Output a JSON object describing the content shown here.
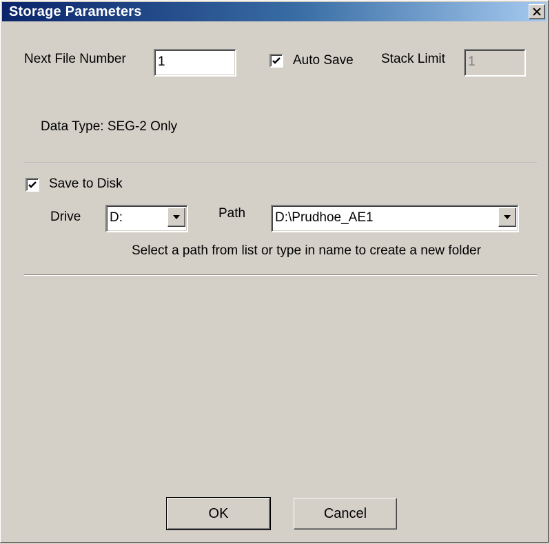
{
  "window": {
    "title": "Storage Parameters"
  },
  "form": {
    "next_file_number_label": "Next File Number",
    "next_file_number_value": "1",
    "auto_save_label": "Auto Save",
    "auto_save_checked": true,
    "stack_limit_label": "Stack Limit",
    "stack_limit_value": "1",
    "data_type_text": "Data Type: SEG-2 Only",
    "save_to_disk_label": "Save to Disk",
    "save_to_disk_checked": true,
    "drive_label": "Drive",
    "drive_value": "D:",
    "path_label": "Path",
    "path_value": "D:\\Prudhoe_AE1",
    "path_hint": "Select a path from list or type in name to create a new folder"
  },
  "buttons": {
    "ok_label": "OK",
    "cancel_label": "Cancel"
  },
  "icons": {
    "close": "close-icon",
    "check": "checkmark-icon",
    "dropdown": "chevron-down-icon"
  },
  "colors": {
    "dialog_bg": "#d4d0c8",
    "title_start": "#0a246a",
    "title_end": "#a6caf0"
  }
}
